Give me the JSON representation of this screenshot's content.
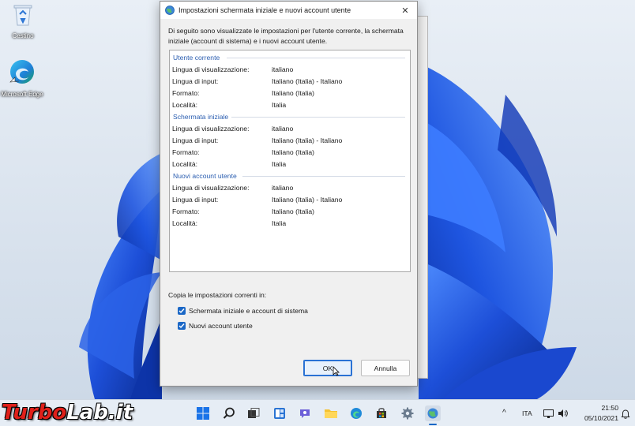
{
  "desktop": {
    "icons": [
      {
        "label": "Cestino",
        "icon": "recycle-bin-icon"
      },
      {
        "label": "Microsoft Edge",
        "icon": "edge-icon"
      }
    ]
  },
  "dialog": {
    "title": "Impostazioni schermata iniziale e nuovi account utente",
    "close_glyph": "✕",
    "intro": "Di seguito sono visualizzate le impostazioni per l'utente corrente, la schermata iniziale (account di sistema) e i nuovi account utente.",
    "groups": [
      {
        "header": "Utente corrente",
        "rows": [
          {
            "key": "Lingua di visualizzazione:",
            "value": "italiano"
          },
          {
            "key": "Lingua di input:",
            "value": "Italiano (Italia) - Italiano"
          },
          {
            "key": "Formato:",
            "value": "Italiano (Italia)"
          },
          {
            "key": "Località:",
            "value": "Italia"
          }
        ]
      },
      {
        "header": "Schermata iniziale",
        "rows": [
          {
            "key": "Lingua di visualizzazione:",
            "value": "italiano"
          },
          {
            "key": "Lingua di input:",
            "value": "Italiano (Italia) - Italiano"
          },
          {
            "key": "Formato:",
            "value": "Italiano (Italia)"
          },
          {
            "key": "Località:",
            "value": "Italia"
          }
        ]
      },
      {
        "header": "Nuovi account utente",
        "rows": [
          {
            "key": "Lingua di visualizzazione:",
            "value": "italiano"
          },
          {
            "key": "Lingua di input:",
            "value": "Italiano (Italia) - Italiano"
          },
          {
            "key": "Formato:",
            "value": "Italiano (Italia)"
          },
          {
            "key": "Località:",
            "value": "Italia"
          }
        ]
      }
    ],
    "copy_label": "Copia le impostazioni correnti in:",
    "checkboxes": [
      {
        "label": "Schermata iniziale e account di sistema",
        "checked": true
      },
      {
        "label": "Nuovi account utente",
        "checked": true
      }
    ],
    "ok_label": "OK",
    "cancel_label": "Annulla"
  },
  "taskbar": {
    "apps": [
      "start-icon",
      "search-icon",
      "task-view-icon",
      "widgets-icon",
      "chat-icon",
      "file-explorer-icon",
      "edge-icon",
      "store-icon",
      "settings-icon",
      "region-settings-icon"
    ],
    "language": "ITA",
    "time": "21:50",
    "date": "05/10/2021"
  },
  "watermark": {
    "part1": "Turbo",
    "part2": "Lab.it"
  },
  "colors": {
    "accent": "#1a67c6",
    "group_header": "#2a5db0",
    "wallpaper_blue": "#1f4fd6"
  }
}
